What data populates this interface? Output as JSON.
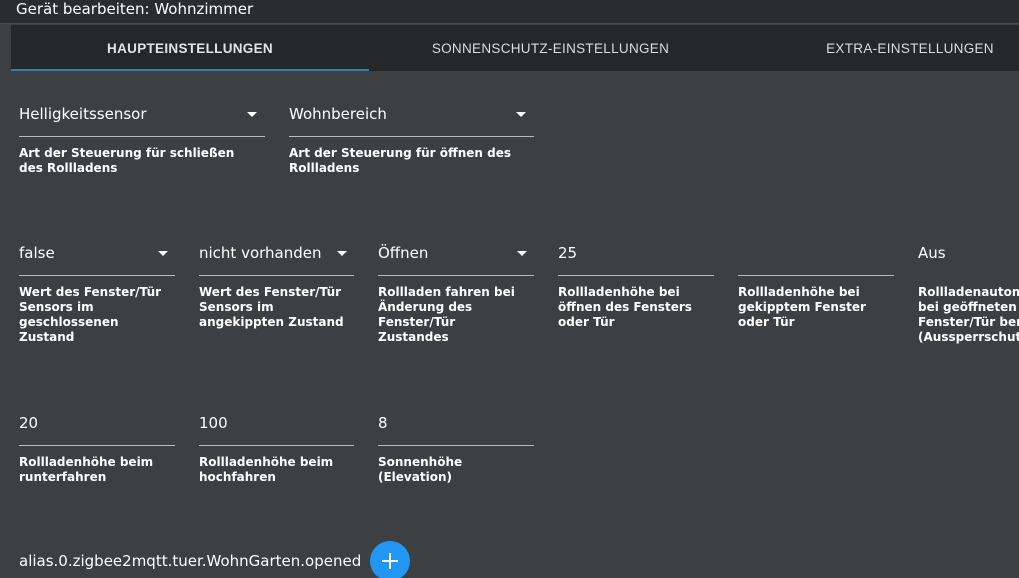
{
  "dialog": {
    "title": "Gerät bearbeiten: Wohnzimmer"
  },
  "tabs": [
    {
      "label": "HAUPTEINSTELLUNGEN",
      "active": true
    },
    {
      "label": "SONNENSCHUTZ-EINSTELLUNGEN",
      "active": false
    },
    {
      "label": "EXTRA-EINSTELLUNGEN",
      "active": false
    }
  ],
  "row1": [
    {
      "value": "Helligkeitssensor",
      "hint": "Art der Steuerung für schließen des Rollladens",
      "dropdown": true
    },
    {
      "value": "Wohnbereich",
      "hint": "Art der Steuerung für öffnen des Rollladens",
      "dropdown": true
    }
  ],
  "row2": [
    {
      "value": "false",
      "hint": "Wert des Fenster/Tür Sensors im geschlossenen Zustand",
      "dropdown": true
    },
    {
      "value": "nicht vorhanden",
      "hint": "Wert des Fenster/Tür Sensors im angekippten Zustand",
      "dropdown": true
    },
    {
      "value": "Öffnen",
      "hint": "Rollladen fahren bei Änderung des Fenster/Tür Zustandes",
      "dropdown": true
    },
    {
      "value": "25",
      "hint": "Rollladenhöhe bei öffnen des Fensters oder Tür",
      "dropdown": false
    },
    {
      "value": "",
      "hint": "Rollladenhöhe bei gekipptem Fenster oder Tür",
      "dropdown": false
    },
    {
      "value": "Aus",
      "hint": "Rollladenautomatik bei geöffneten Fenster/Tür benutzen (Aussperrschutz)",
      "dropdown": false
    }
  ],
  "row3": [
    {
      "value": "20",
      "hint": "Rollladenhöhe beim runterfahren",
      "dropdown": false
    },
    {
      "value": "100",
      "hint": "Rollladenhöhe beim hochfahren",
      "dropdown": false
    },
    {
      "value": "8",
      "hint": "Sonnenhöhe (Elevation)",
      "dropdown": false
    }
  ],
  "sensor": {
    "path": "alias.0.zigbee2mqtt.tuer.WohnGarten.opened"
  },
  "add_button": {
    "icon": "plus-icon"
  }
}
